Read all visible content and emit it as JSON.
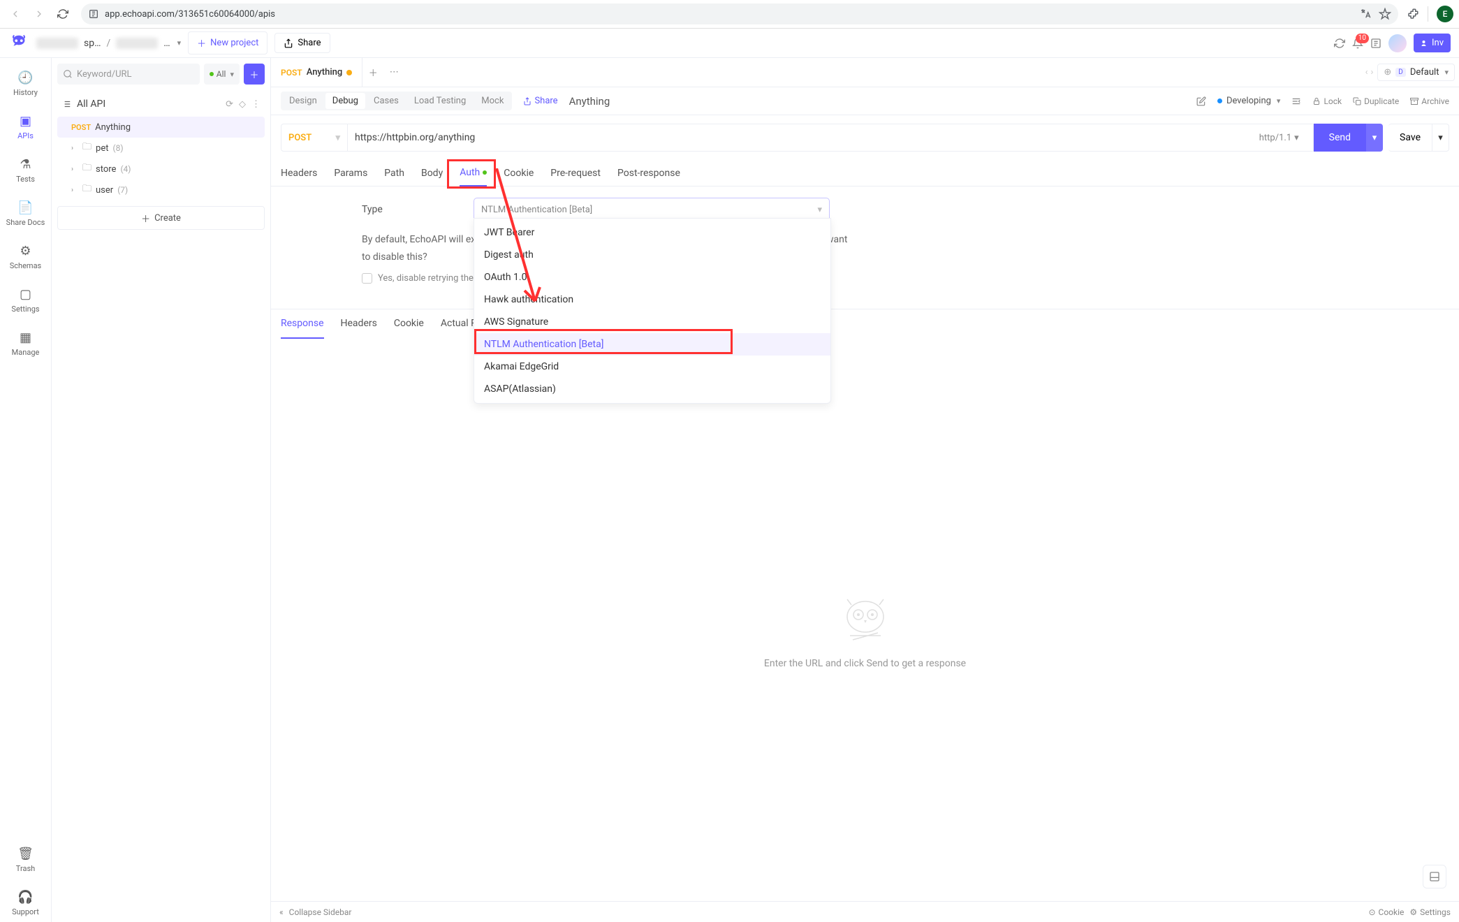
{
  "browser": {
    "url": "app.echoapi.com/313651c60064000/apis",
    "avatar_initial": "E"
  },
  "topbar": {
    "breadcrumb_1": "sp…",
    "breadcrumb_2": "…",
    "sep": "/",
    "new_project": "New project",
    "share": "Share",
    "notif_count": "10",
    "invite": "Inv"
  },
  "nav": {
    "history": "History",
    "apis": "APIs",
    "tests": "Tests",
    "share_docs": "Share Docs",
    "schemas": "Schemas",
    "settings": "Settings",
    "manage": "Manage",
    "trash": "Trash",
    "support": "Support"
  },
  "sidebar": {
    "search_placeholder": "Keyword/URL",
    "filter_all": "All",
    "all_api": "All API",
    "create": "Create",
    "items": [
      {
        "method": "POST",
        "name": "Anything"
      },
      {
        "folder": true,
        "name": "pet",
        "count": "(8)"
      },
      {
        "folder": true,
        "name": "store",
        "count": "(4)"
      },
      {
        "folder": true,
        "name": "user",
        "count": "(7)"
      }
    ]
  },
  "tabs": {
    "current": {
      "method": "POST",
      "title": "Anything"
    },
    "env_badge": "D",
    "env_name": "Default"
  },
  "toolbar": {
    "modes": [
      "Design",
      "Debug",
      "Cases",
      "Load Testing",
      "Mock"
    ],
    "share": "Share",
    "title": "Anything",
    "status": "Developing",
    "lock": "Lock",
    "duplicate": "Duplicate",
    "archive": "Archive"
  },
  "request": {
    "method": "POST",
    "url": "https://httpbin.org/anything",
    "proto": "http/1.1",
    "send": "Send",
    "save": "Save",
    "tabs": [
      "Headers",
      "Params",
      "Path",
      "Body",
      "Auth",
      "Cookie",
      "Pre-request",
      "Post-response"
    ]
  },
  "auth": {
    "type_label": "Type",
    "selected": "NTLM Authentication [Beta]",
    "desc_1": "By default, EchoAPI will extract values from the received response, add it to the request, and retry it.",
    "desc_2": "Do you want to disable this?",
    "checkbox": "Yes, disable retrying the request",
    "options": [
      "JWT Bearer",
      "Digest auth",
      "OAuth 1.0",
      "Hawk authentication",
      "AWS Signature",
      "NTLM Authentication [Beta]",
      "Akamai EdgeGrid",
      "ASAP(Atlassian)"
    ]
  },
  "response": {
    "tabs": [
      "Response",
      "Headers",
      "Cookie",
      "Actual Request"
    ],
    "hint": "Enter the URL and click Send to get a response"
  },
  "footer": {
    "collapse": "Collapse Sidebar",
    "cookie": "Cookie",
    "settings": "Settings"
  }
}
